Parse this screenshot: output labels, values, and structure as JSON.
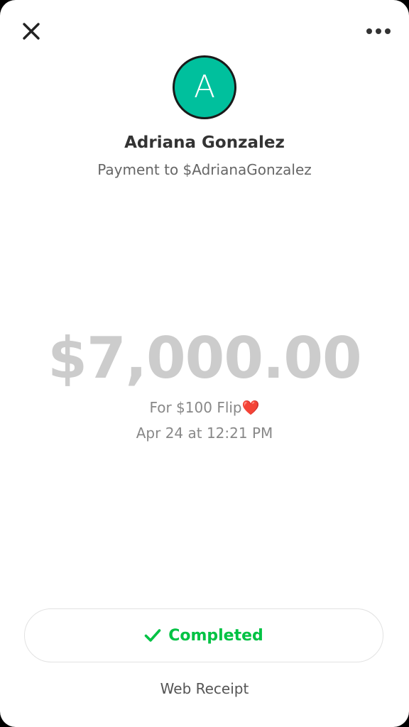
{
  "header": {
    "close_icon": "close-icon",
    "more_icon": "more-horizontal-icon"
  },
  "recipient": {
    "avatar_initial": "A",
    "avatar_color": "#00c09d",
    "name": "Adriana Gonzalez",
    "subtitle": "Payment to $AdrianaGonzalez"
  },
  "payment": {
    "amount": "$7,000.00",
    "note": "For $100 Flip",
    "note_emoji": "❤️",
    "date": "Apr 24 at 12:21 PM"
  },
  "status": {
    "label": "Completed",
    "icon": "checkmark-icon",
    "color": "#00c244"
  },
  "footer": {
    "web_receipt_label": "Web Receipt"
  }
}
